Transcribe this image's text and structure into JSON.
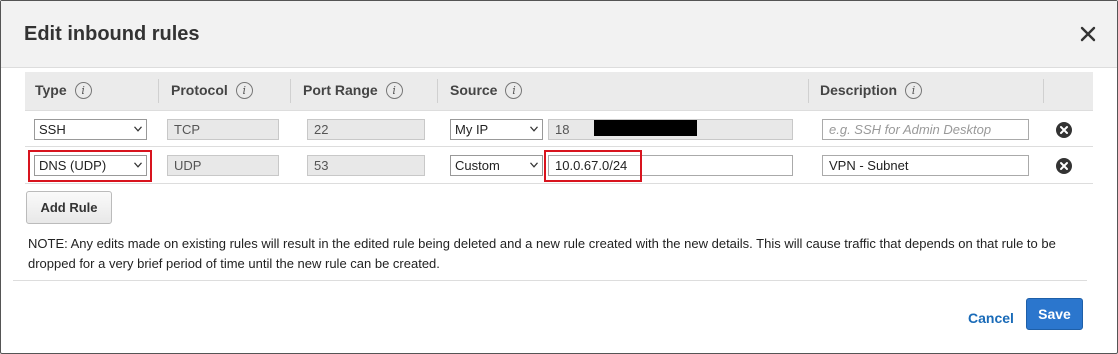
{
  "dialog": {
    "title": "Edit inbound rules",
    "close_icon": "close-icon"
  },
  "table": {
    "headers": {
      "type": "Type",
      "protocol": "Protocol",
      "port_range": "Port Range",
      "source": "Source",
      "description": "Description"
    },
    "info_glyph": "i",
    "rows": [
      {
        "type": "SSH",
        "protocol": "TCP",
        "port_range": "22",
        "source_type": "My IP",
        "source_value": "18",
        "description_placeholder": "e.g. SSH for Admin Desktop",
        "description": ""
      },
      {
        "type": "DNS (UDP)",
        "protocol": "UDP",
        "port_range": "53",
        "source_type": "Custom",
        "source_value": "10.0.67.0/24",
        "description_placeholder": "",
        "description": "VPN - Subnet"
      }
    ]
  },
  "actions": {
    "add_rule": "Add Rule",
    "cancel": "Cancel",
    "save": "Save"
  },
  "note": "NOTE: Any edits made on existing rules will result in the edited rule being deleted and a new rule created with the new details. This will cause traffic that depends on that rule to be dropped for a very brief period of time until the new rule can be created.",
  "colors": {
    "highlight": "#d8141e",
    "primary": "#2b76cd",
    "link": "#1a6bb8"
  }
}
